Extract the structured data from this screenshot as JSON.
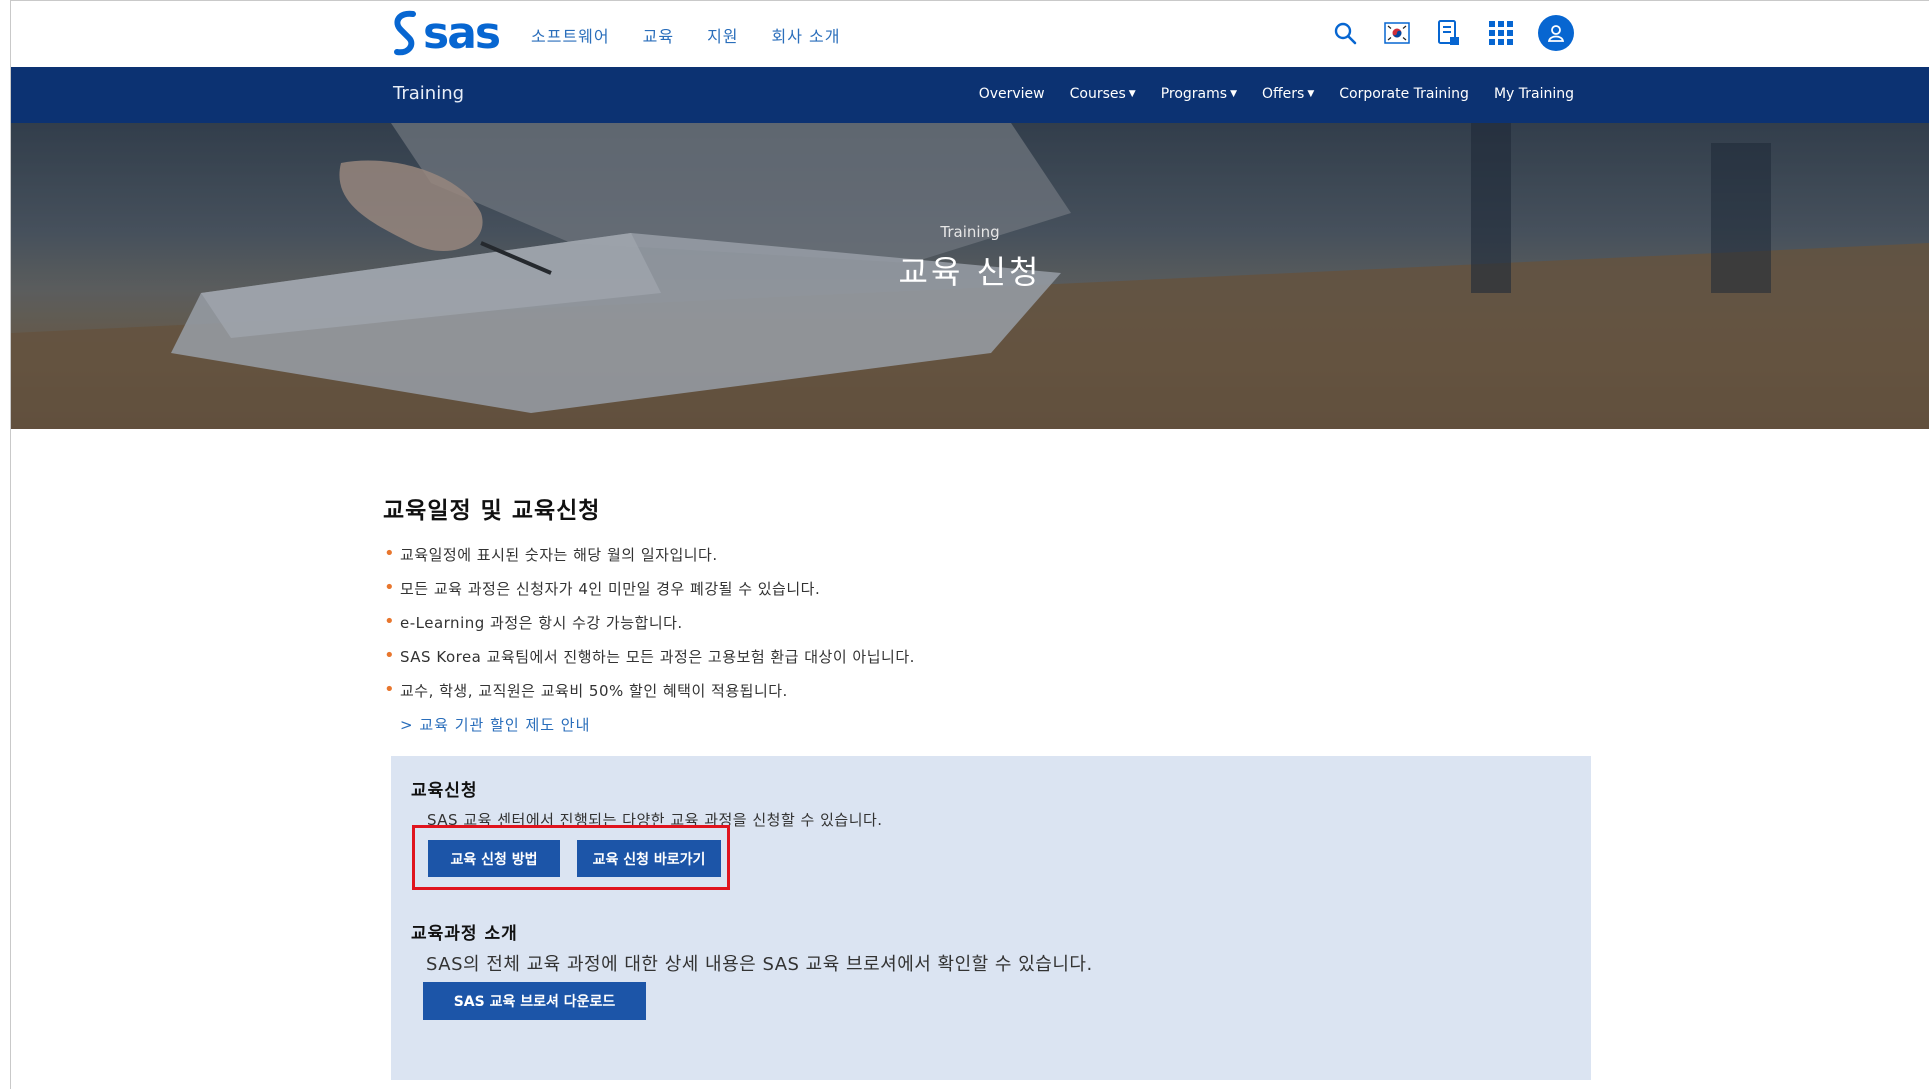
{
  "header": {
    "logo_text": "sas",
    "nav": [
      "소프트웨어",
      "교육",
      "지원",
      "회사 소개"
    ],
    "icons": [
      "search-icon",
      "korea-flag-icon",
      "document-icon",
      "apps-grid-icon",
      "user-avatar-icon"
    ],
    "brand_color": "#0766d1"
  },
  "training_bar": {
    "title": "Training",
    "nav": {
      "overview": "Overview",
      "courses": "Courses",
      "programs": "Programs",
      "offers": "Offers",
      "corporate": "Corporate Training",
      "my_training": "My Training"
    },
    "bg_color": "#0c3272"
  },
  "hero": {
    "small": "Training",
    "title": "교육 신청"
  },
  "main": {
    "section_title": "교육일정 및 교육신청",
    "bullets": [
      "교육일정에 표시된 숫자는 해당 월의 일자입니다.",
      "모든 교육 과정은 신청자가 4인 미만일 경우 폐강될 수 있습니다.",
      "e-Learning 과정은 항시 수강 가능합니다.",
      "SAS Korea 교육팀에서 진행하는 모든 과정은 고용보험 환급 대상이 아닙니다.",
      "교수, 학생, 교직원은 교육비 50% 할인 혜택이 적용됩니다."
    ],
    "discount_link": "> 교육 기관 할인 제도 안내"
  },
  "apply_box": {
    "heading": "교육신청",
    "text": "SAS 교육 센터에서 진행되는 다양한 교육 과정을 신청할 수 있습니다.",
    "btn_howto": "교육 신청 방법",
    "btn_go": "교육 신청 바로가기",
    "course_heading": "교육과정 소개",
    "course_text": "SAS의 전체 교육 과정에 대한 상세 내용은 SAS 교육 브로셔에서 확인할 수 있습니다.",
    "btn_download": "SAS 교육 브로셔 다운로드",
    "highlight_color": "#e0141e"
  }
}
